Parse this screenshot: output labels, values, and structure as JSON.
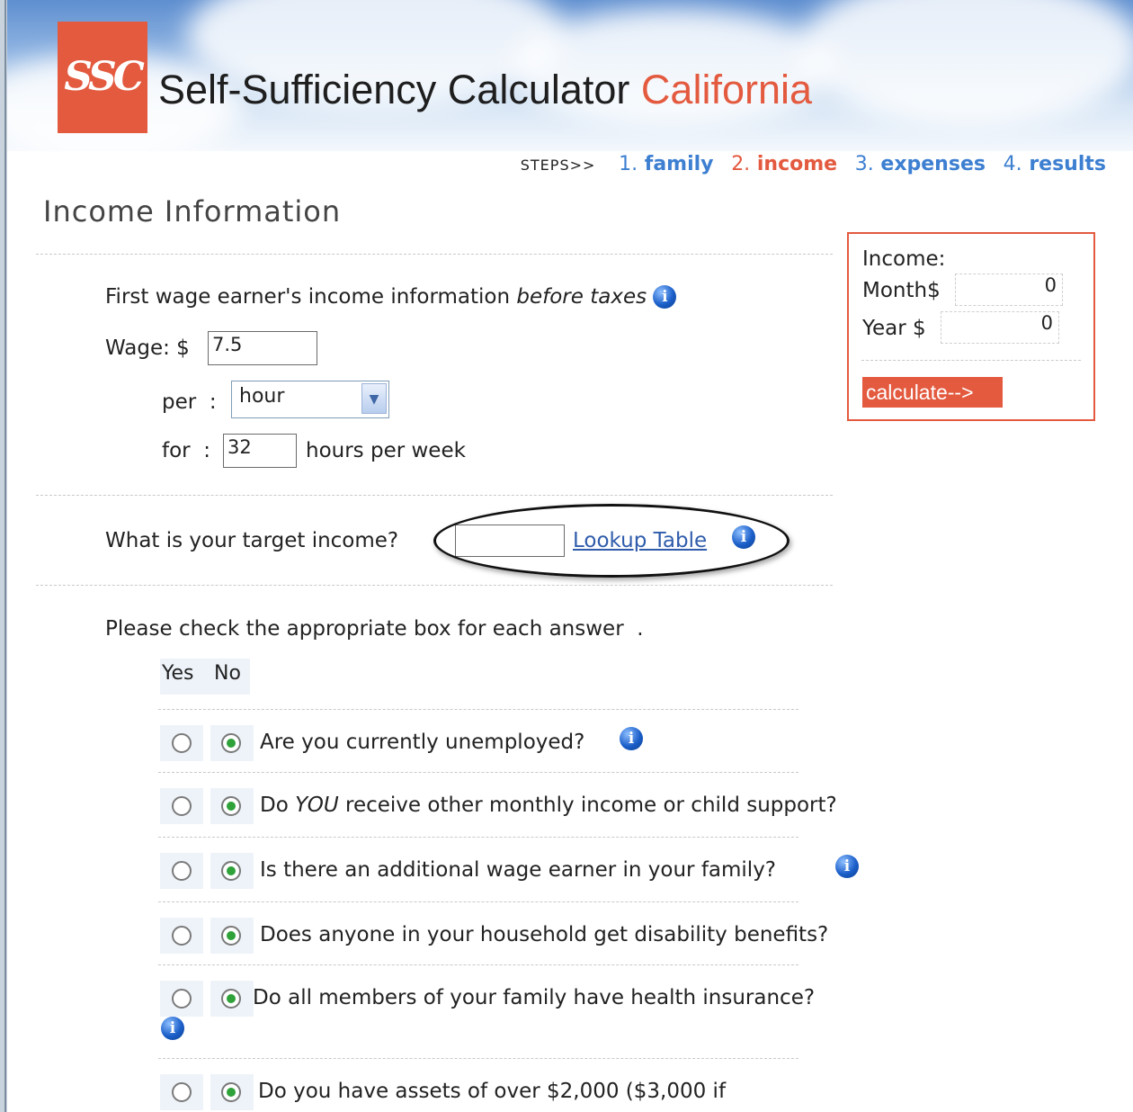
{
  "header": {
    "logo_text": "SSC",
    "brand_main": "Self-Sufficiency Calculator",
    "brand_state": "California"
  },
  "steps": {
    "label": "STEPS>>",
    "items": [
      {
        "num": "1.",
        "label": "family",
        "active": false
      },
      {
        "num": "2.",
        "label": "income",
        "active": true
      },
      {
        "num": "3.",
        "label": "expenses",
        "active": false
      },
      {
        "num": "4.",
        "label": "results",
        "active": false
      }
    ]
  },
  "page_title": "Income Information",
  "wage_section": {
    "intro": "First wage earner's income information",
    "intro_em": "before taxes",
    "wage_label": "Wage: $",
    "wage_value": "7.5",
    "per_label": "per",
    "colon": ":",
    "per_value": "hour",
    "for_label": "for",
    "hours_value": "32",
    "hours_suffix": "hours per week"
  },
  "target": {
    "question": "What is your target income?",
    "value": "",
    "lookup_link": "Lookup Table"
  },
  "income_panel": {
    "title": "Income:",
    "month_label": "Month$",
    "month_value": "0",
    "year_label": "Year $",
    "year_value": "0",
    "calculate_label": "calculate-->"
  },
  "questions": {
    "instruction": "Please check the appropriate box for each answer",
    "instruction_end": ".",
    "yes_label": "Yes",
    "no_label": "No",
    "items": [
      {
        "text": "Are you currently unemployed?",
        "answer": "no"
      },
      {
        "pre": "Do",
        "em": "YOU",
        "post": "receive other monthly income or child support?",
        "answer": "no"
      },
      {
        "text": "Is there an additional wage earner in your family?",
        "answer": "no"
      },
      {
        "text": "Does anyone in your household get disability benefits?",
        "answer": "no"
      },
      {
        "text": "Do all members of your family have health insurance?",
        "answer": "no"
      },
      {
        "text": "Do you have assets of over $2,000 ($3,000 if",
        "answer": "no"
      }
    ]
  },
  "icons": {
    "info": "info-icon",
    "dropdown": "chevron-down-icon"
  },
  "colors": {
    "accent": "#e35a3f",
    "link": "#3d7fd1"
  }
}
